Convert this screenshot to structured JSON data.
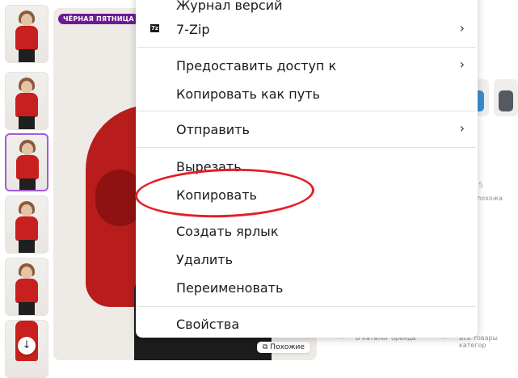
{
  "product_page": {
    "badge": "ЧЁРНАЯ ПЯТНИЦА",
    "similar_button": "Похожие",
    "side_text_1": "похожа",
    "side_number": "5",
    "footer_links": [
      "В каталог бренда",
      "Все товары категор"
    ],
    "thumbnail_down_icon": "↓"
  },
  "context_menu": {
    "items": [
      {
        "label": "Журнал версий",
        "submenu": false
      },
      {
        "label": "7-Zip",
        "submenu": true,
        "icon": "7z"
      },
      {
        "label": "Предоставить доступ к",
        "submenu": true
      },
      {
        "label": "Копировать как путь",
        "submenu": false
      },
      {
        "label": "Отправить",
        "submenu": true
      },
      {
        "label": "Вырезать",
        "submenu": false
      },
      {
        "label": "Копировать",
        "submenu": false,
        "highlighted": true
      },
      {
        "label": "Создать ярлык",
        "submenu": false
      },
      {
        "label": "Удалить",
        "submenu": false
      },
      {
        "label": "Переименовать",
        "submenu": false
      },
      {
        "label": "Свойства",
        "submenu": false
      }
    ],
    "arrow_glyph": "›",
    "annotation_color": "#e41e26"
  },
  "colors": {
    "jacket_red": "#c7201e",
    "badge_purple": "#6e1a96",
    "selected_thumb_border": "#a35bd6"
  }
}
